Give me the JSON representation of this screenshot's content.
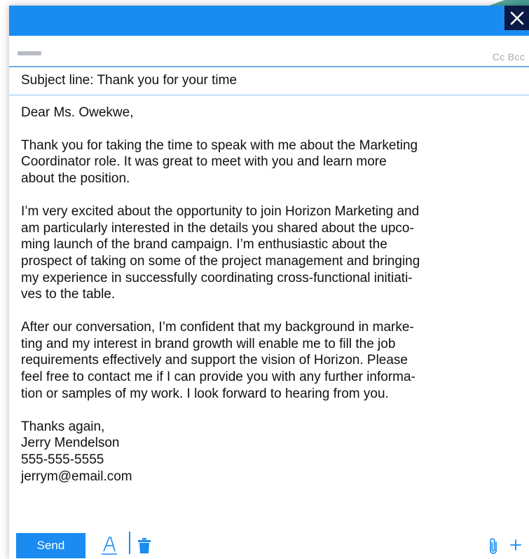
{
  "colors": {
    "accent": "#1a8bf0",
    "close_bg": "#0b1a44",
    "placeholder": "#b9bdc3",
    "muted_text": "#a3a9b0",
    "body_text": "#111111"
  },
  "titlebar": {
    "close_icon": "close-icon"
  },
  "recipients": {
    "cc_bcc_label": "Cc Bcc"
  },
  "subject": {
    "text": "Subject line: Thank you for your time"
  },
  "body": {
    "greeting": "Dear Ms. Owekwe,",
    "paragraph1": [
      "Thank you for taking the time to speak with me about the Marketing",
      "Coordinator role. It was great to meet with you and learn more",
      "about the position."
    ],
    "paragraph2": [
      "I’m very excited about the opportunity to join Horizon Marketing and",
      "am particularly interested in the details you shared about the upco-",
      "ming launch of the brand campaign. I’m enthusiastic about the",
      "prospect of taking on some of the project management and bringing",
      "my experience in successfully coordinating cross-functional initiati-",
      "ves to the table."
    ],
    "paragraph3": [
      "After our conversation, I’m confident that my background in marke-",
      "ting and my interest in brand growth will enable me to fill the job",
      "requirements effectively and support the vision of Horizon. Please",
      "feel free to contact me if I can provide you with any further informa-",
      "tion or samples of my work. I look forward to hearing from you."
    ],
    "signature": [
      "Thanks again,",
      "Jerry Mendelson",
      "555-555-5555",
      "jerrym@email.com"
    ]
  },
  "toolbar": {
    "send_label": "Send",
    "icons": [
      "text-format-icon",
      "trash-icon",
      "paperclip-icon",
      "plus-icon"
    ]
  }
}
